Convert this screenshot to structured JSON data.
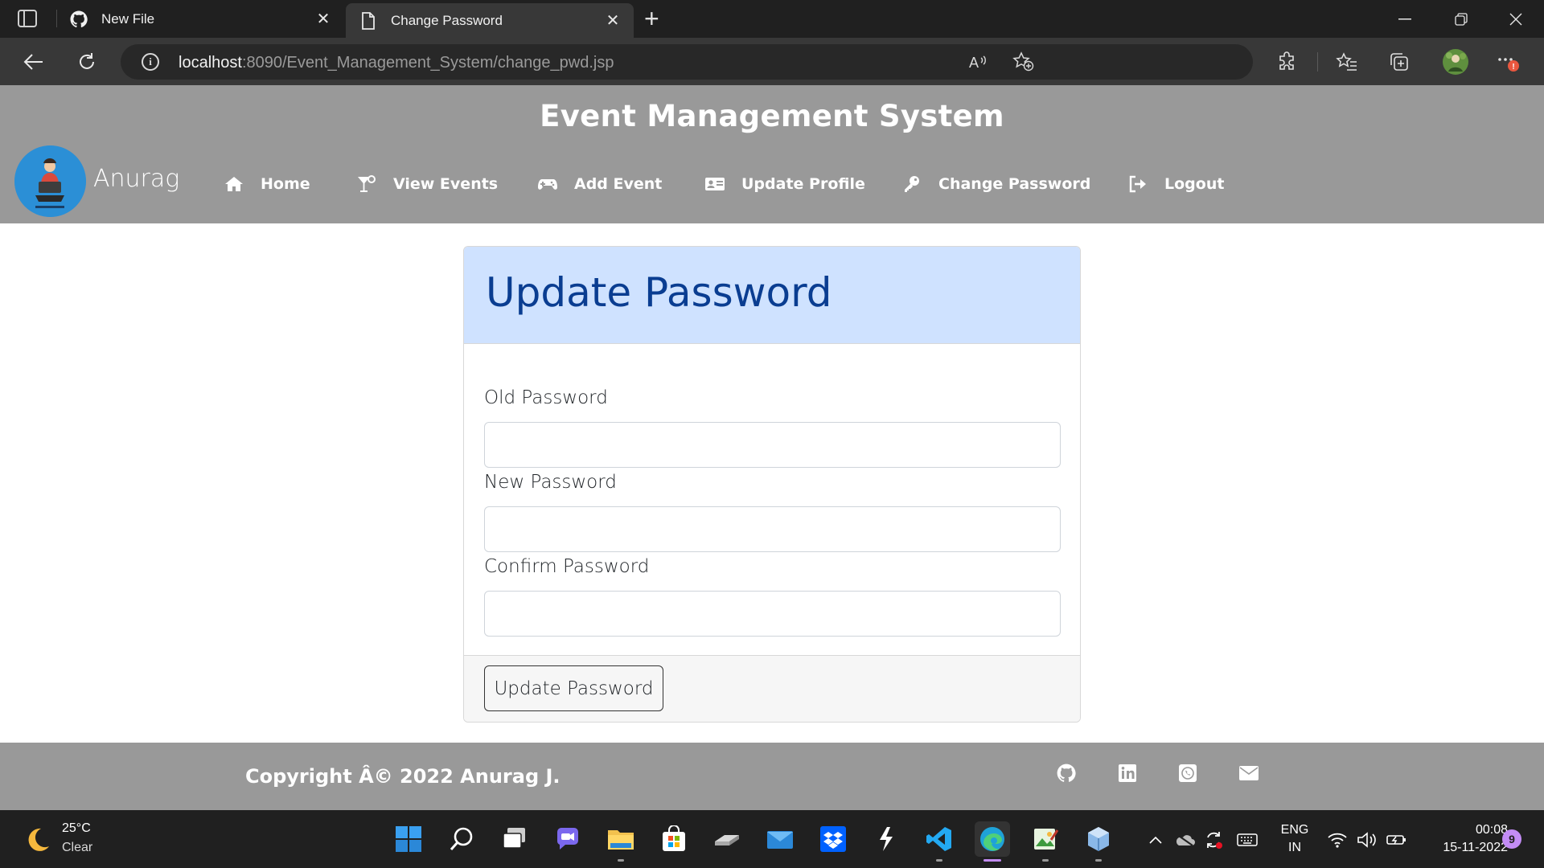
{
  "browser": {
    "tabs": [
      {
        "title": "New File",
        "favicon": "github-icon",
        "active": false
      },
      {
        "title": "Change Password",
        "favicon": "page-icon",
        "active": true
      }
    ],
    "url_host": "localhost",
    "url_rest": ":8090/Event_Management_System/change_pwd.jsp"
  },
  "header": {
    "site_title": "Event Management System",
    "user_name": "Anurag",
    "nav": [
      {
        "label": "Home",
        "icon": "home-icon"
      },
      {
        "label": "View Events",
        "icon": "cocktail-icon"
      },
      {
        "label": "Add Event",
        "icon": "gamepad-icon"
      },
      {
        "label": "Update Profile",
        "icon": "id-card-icon"
      },
      {
        "label": "Change Password",
        "icon": "key-icon"
      },
      {
        "label": "Logout",
        "icon": "logout-icon"
      }
    ]
  },
  "form": {
    "title": "Update Password",
    "old_label": "Old Password",
    "new_label": "New Password",
    "confirm_label": "Confirm Password",
    "old_value": "",
    "new_value": "",
    "confirm_value": "",
    "submit_label": "Update Password"
  },
  "footer": {
    "copyright": "Copyright Â© 2022 Anurag J.",
    "social": [
      "github-icon",
      "linkedin-icon",
      "whatsapp-icon",
      "envelope-icon"
    ]
  },
  "taskbar": {
    "temperature": "25°C",
    "weather": "Clear",
    "lang_top": "ENG",
    "lang_bottom": "IN",
    "time": "00:08",
    "date": "15-11-2022",
    "notifications": "9"
  },
  "colors": {
    "header_bg": "#999999",
    "card_header_bg": "#cfe2ff",
    "card_title": "#0a3d91",
    "accent_purple": "#c38cf5"
  }
}
